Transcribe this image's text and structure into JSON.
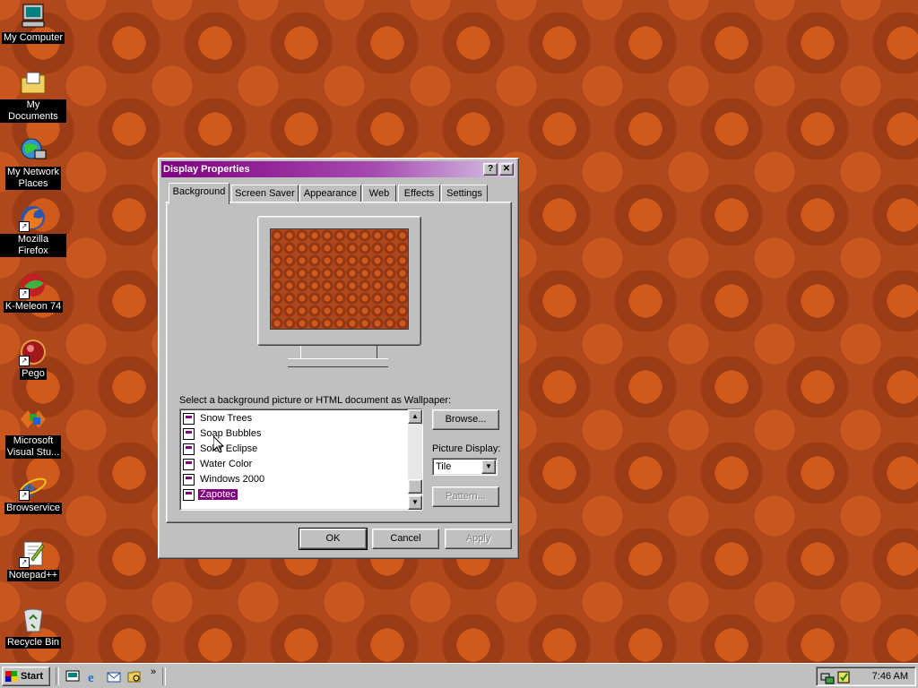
{
  "desktop": {
    "icons": [
      {
        "label": "My Computer",
        "icon": "my-computer-icon"
      },
      {
        "label": "My Documents",
        "icon": "my-documents-icon"
      },
      {
        "label_line1": "My Network",
        "label_line2": "Places",
        "icon": "network-places-icon"
      },
      {
        "label": "Mozilla Firefox",
        "icon": "firefox-icon"
      },
      {
        "label": "K-Meleon 74",
        "icon": "k-meleon-icon"
      },
      {
        "label": "Pego",
        "icon": "pego-icon"
      },
      {
        "label_line1": "Microsoft",
        "label_line2": "Visual Stu...",
        "icon": "visual-studio-icon"
      },
      {
        "label": "Browservice",
        "icon": "internet-explorer-icon"
      },
      {
        "label": "Notepad++",
        "icon": "notepad-plus-plus-icon"
      },
      {
        "label": "Recycle Bin",
        "icon": "recycle-bin-icon"
      }
    ]
  },
  "dialog": {
    "title": "Display Properties",
    "help_button": "?",
    "close_button": "✕",
    "tabs": [
      "Background",
      "Screen Saver",
      "Appearance",
      "Web",
      "Effects",
      "Settings"
    ],
    "active_tab": "Background",
    "wallpaper_prompt": "Select a background picture or HTML document as Wallpaper:",
    "wallpaper_list": [
      {
        "label": "Snow Trees",
        "selected": false
      },
      {
        "label": "Soap Bubbles",
        "selected": false
      },
      {
        "label": "Solar Eclipse",
        "selected": false
      },
      {
        "label": "Water Color",
        "selected": false
      },
      {
        "label": "Windows 2000",
        "selected": false
      },
      {
        "label": "Zapotec",
        "selected": true
      }
    ],
    "browse_button": "Browse...",
    "picture_display_label": "Picture Display:",
    "picture_display_value": "Tile",
    "pattern_button": "Pattern...",
    "ok_button": "OK",
    "cancel_button": "Cancel",
    "apply_button": "Apply"
  },
  "taskbar": {
    "start_label": "Start",
    "quick_launch": [
      "show-desktop-icon",
      "internet-explorer-icon",
      "outlook-express-icon",
      "explorer-icon"
    ],
    "more_label": "»",
    "clock": "7:46 AM"
  },
  "colors": {
    "title_start": "#800080",
    "selection": "#800080",
    "desktop_base": "#b0481c"
  }
}
